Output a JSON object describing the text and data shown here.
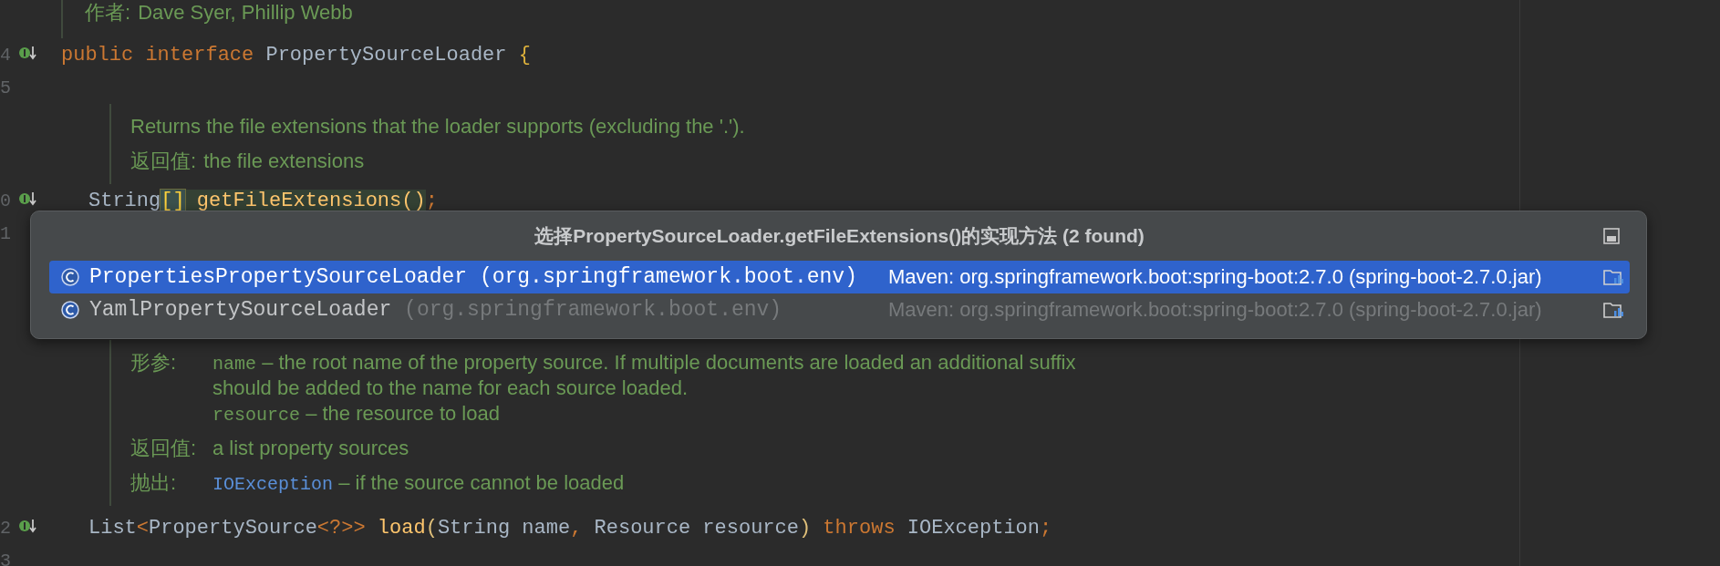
{
  "editor": {
    "rows": [
      {
        "kind": "class-doc",
        "items": [
          {
            "kind": "tag",
            "label": "作者:",
            "entries": [
              {
                "text": "Dave Syer, Phillip Webb"
              }
            ]
          }
        ]
      },
      {
        "kind": "code",
        "number": "4",
        "marker": true,
        "tokens": [
          {
            "kind": "keyword",
            "text": "public"
          },
          {
            "kind": "keyword",
            "text": " interface"
          },
          {
            "kind": "plain",
            "text": " PropertySourceLoader "
          },
          {
            "kind": "brace",
            "text": "{"
          }
        ]
      },
      {
        "kind": "code",
        "number": "5",
        "marker": false,
        "tokens": []
      },
      {
        "kind": "member-doc",
        "items": [
          {
            "kind": "paragraph",
            "text": "Returns the file extensions that the loader supports (excluding the '.')."
          },
          {
            "kind": "tag",
            "label": "返回值:",
            "entries": [
              {
                "text": "the file extensions"
              }
            ]
          }
        ]
      },
      {
        "kind": "member-code",
        "number": "0",
        "marker": true,
        "tokens": [
          {
            "kind": "plain",
            "text": "String"
          },
          {
            "kind": "bracket-match",
            "text": "[]"
          },
          {
            "kind": "method-hl",
            "text": " getFileExtensions()"
          },
          {
            "kind": "punct",
            "text": ";"
          }
        ]
      },
      {
        "kind": "code",
        "number": "1",
        "marker": false,
        "tokens": []
      },
      {
        "kind": "member-doc",
        "items": [
          {
            "kind": "tag",
            "label": "形参:",
            "entries": [
              {
                "param": "name",
                "text": " – the root name of the property source. If multiple documents are loaded an additional suffix should be added to the name for each source loaded."
              },
              {
                "param": "resource",
                "text": " – the resource to load"
              }
            ]
          },
          {
            "kind": "tag",
            "label": "返回值:",
            "entries": [
              {
                "text": "a list property sources"
              }
            ]
          },
          {
            "kind": "tag",
            "label": "抛出:",
            "entries": [
              {
                "link": "IOException",
                "text": " – if the source cannot be loaded"
              }
            ]
          }
        ]
      },
      {
        "kind": "member-code",
        "number": "2",
        "marker": true,
        "tokens": [
          {
            "kind": "plain",
            "text": "List"
          },
          {
            "kind": "punct",
            "text": "<"
          },
          {
            "kind": "plain",
            "text": "PropertySource"
          },
          {
            "kind": "punct",
            "text": "<?>>"
          },
          {
            "kind": "method",
            "text": " load"
          },
          {
            "kind": "paren",
            "text": "("
          },
          {
            "kind": "plain",
            "text": "String name"
          },
          {
            "kind": "punct",
            "text": ","
          },
          {
            "kind": "plain",
            "text": " Resource resource"
          },
          {
            "kind": "paren",
            "text": ")"
          },
          {
            "kind": "keyword",
            "text": " throws"
          },
          {
            "kind": "plain",
            "text": " IOException"
          },
          {
            "kind": "punct",
            "text": ";"
          }
        ]
      },
      {
        "kind": "code",
        "number": "3",
        "marker": false,
        "tokens": []
      }
    ]
  },
  "popup": {
    "title": "选择PropertySourceLoader.getFileExtensions()的实现方法 (2 found)",
    "items": [
      {
        "name": "PropertiesPropertySourceLoader",
        "package": "(org.springframework.boot.env)",
        "location": "Maven: org.springframework.boot:spring-boot:2.7.0 (spring-boot-2.7.0.jar)",
        "selected": true
      },
      {
        "name": "YamlPropertySourceLoader",
        "package": "(org.springframework.boot.env)",
        "location": "Maven: org.springframework.boot:spring-boot:2.7.0 (spring-boot-2.7.0.jar)",
        "selected": false
      }
    ]
  }
}
